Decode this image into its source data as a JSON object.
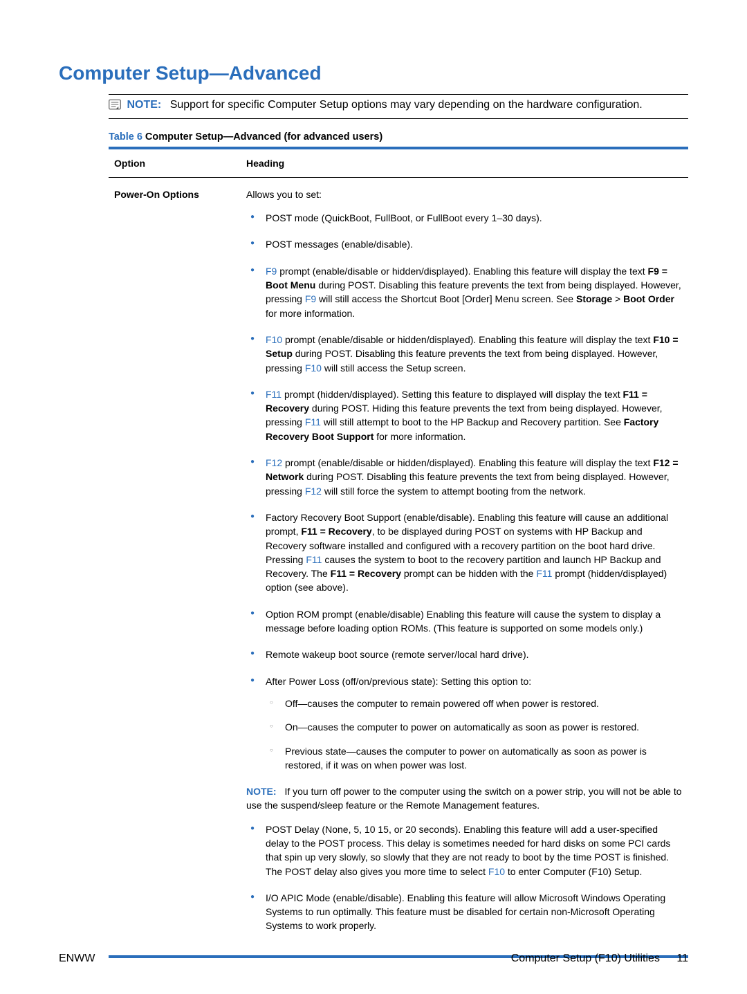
{
  "heading": "Computer Setup—Advanced",
  "note_block": {
    "label": "NOTE:",
    "text": "Support for specific Computer Setup options may vary depending on the hardware configuration."
  },
  "table": {
    "title_prefix": "Table 6",
    "title_text": "  Computer Setup—Advanced (for advanced users)",
    "col_option": "Option",
    "col_heading": "Heading",
    "row": {
      "option": "Power-On Options",
      "intro": "Allows you to set:",
      "bullets": {
        "b1": "POST mode (QuickBoot, FullBoot, or FullBoot every 1–30 days).",
        "b2": "POST messages (enable/disable).",
        "b3_a": "F9",
        "b3_b": " prompt (enable/disable or hidden/displayed). Enabling this feature will display the text ",
        "b3_c": "F9 = Boot Menu",
        "b3_d": " during POST. Disabling this feature prevents the text from being displayed. However, pressing ",
        "b3_e": "F9",
        "b3_f": " will still access the Shortcut Boot [Order] Menu screen. See ",
        "b3_g": "Storage",
        "b3_h": " > ",
        "b3_i": "Boot Order",
        "b3_j": " for more information.",
        "b4_a": "F10",
        "b4_b": " prompt (enable/disable or hidden/displayed). Enabling this feature will display the text ",
        "b4_c": "F10 = Setup",
        "b4_d": " during POST. Disabling this feature prevents the text from being displayed. However, pressing ",
        "b4_e": "F10",
        "b4_f": " will still access the Setup screen.",
        "b5_a": "F11",
        "b5_b": " prompt (hidden/displayed). Setting this feature to displayed will display the text ",
        "b5_c": "F11 = Recovery",
        "b5_d": " during POST. Hiding this feature prevents the text from being displayed. However, pressing ",
        "b5_e": "F11",
        "b5_f": " will still attempt to boot to the HP Backup and Recovery partition. See ",
        "b5_g": "Factory Recovery Boot Support",
        "b5_h": " for more information.",
        "b6_a": "F12",
        "b6_b": " prompt (enable/disable or hidden/displayed). Enabling this feature will display the text ",
        "b6_c": "F12 = Network",
        "b6_d": " during POST. Disabling this feature prevents the text from being displayed. However, pressing ",
        "b6_e": "F12",
        "b6_f": " will still force the system to attempt booting from the network.",
        "b7_a": "Factory Recovery Boot Support (enable/disable). Enabling this feature will cause an additional prompt, ",
        "b7_b": "F11 = Recovery",
        "b7_c": ", to be displayed during POST on systems with HP Backup and Recovery software installed and configured with a recovery partition on the boot hard drive. Pressing ",
        "b7_d": "F11",
        "b7_e": " causes the system to boot to the recovery partition and launch HP Backup and Recovery. The ",
        "b7_f": "F11 = Recovery",
        "b7_g": " prompt can be hidden with the ",
        "b7_h": "F11",
        "b7_i": " prompt (hidden/displayed) option (see above).",
        "b8": "Option ROM prompt (enable/disable) Enabling this feature will cause the system to display a message before loading option ROMs. (This feature is supported on some models only.)",
        "b9": "Remote wakeup boot source (remote server/local hard drive).",
        "b10": "After Power Loss (off/on/previous state): Setting this option to:",
        "s1": "Off—causes the computer to remain powered off when power is restored.",
        "s2": "On—causes the computer to power on automatically as soon as power is restored.",
        "s3": "Previous state—causes the computer to power on automatically as soon as power is restored, if it was on when power was lost.",
        "note_label": "NOTE:",
        "note_text": "If you turn off power to the computer using the switch on a power strip, you will not be able to use the suspend/sleep feature or the Remote Management features.",
        "b11_a": "POST Delay (None, 5, 10 15, or 20 seconds). Enabling this feature will add a user-specified delay to the POST process. This delay is sometimes needed for hard disks on some PCI cards that spin up very slowly, so slowly that they are not ready to boot by the time POST is finished. The POST delay also gives you more time to select ",
        "b11_b": "F10",
        "b11_c": " to enter Computer (F10) Setup.",
        "b12": "I/O APIC Mode (enable/disable). Enabling this feature will allow Microsoft Windows Operating Systems to run optimally. This feature must be disabled for certain non-Microsoft Operating Systems to work properly."
      }
    }
  },
  "footer": {
    "left": "ENWW",
    "right_text": "Computer Setup (F10) Utilities",
    "page_number": "11"
  }
}
